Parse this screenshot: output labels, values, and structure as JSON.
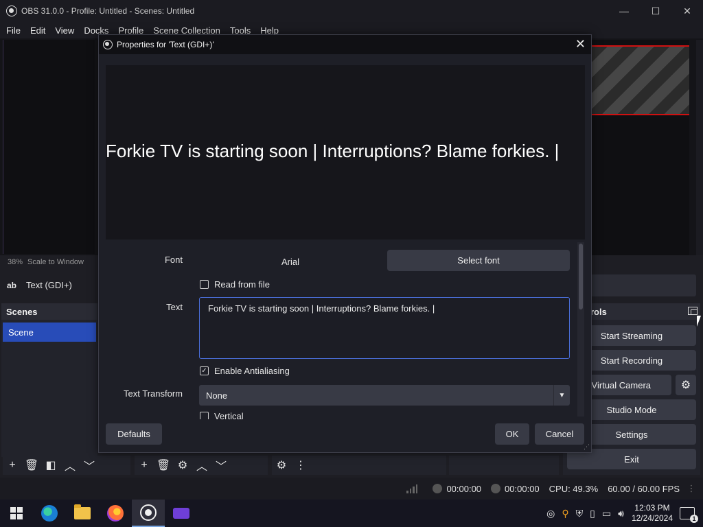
{
  "window": {
    "title": "OBS 31.0.0 - Profile: Untitled - Scenes: Untitled",
    "minimize_glyph": "—",
    "maximize_glyph": "☐",
    "close_glyph": "✕"
  },
  "menubar": [
    "File",
    "Edit",
    "View",
    "Docks",
    "Profile",
    "Scene Collection",
    "Tools",
    "Help"
  ],
  "preview_status": {
    "zoom": "38%",
    "scale_mode": "Scale to Window"
  },
  "sources": {
    "selected_icon": "ab",
    "selected_label": "Text (GDI+)"
  },
  "scenes_dock": {
    "title": "Scenes",
    "items": [
      "Scene"
    ]
  },
  "controls_dock": {
    "title": "rols",
    "buttons": {
      "start_streaming": "Start Streaming",
      "start_recording": "Start Recording",
      "virtual_camera": "rt Virtual Camera",
      "studio_mode": "Studio Mode",
      "settings": "Settings",
      "exit": "Exit"
    }
  },
  "status_bar": {
    "stream_time": "00:00:00",
    "record_time": "00:00:00",
    "cpu": "CPU: 49.3%",
    "fps": "60.00 / 60.00 FPS"
  },
  "dialog": {
    "title": "Properties for 'Text (GDI+)'",
    "preview_text": "Forkie TV is starting soon | Interruptions? Blame forkies. |",
    "font_label": "Font",
    "font_value": "Arial",
    "select_font_button": "Select font",
    "read_from_file_label": "Read from file",
    "read_from_file_checked": false,
    "text_label": "Text",
    "text_value": "Forkie TV is starting soon | Interruptions? Blame forkies. |",
    "antialiasing_label": "Enable Antialiasing",
    "antialiasing_checked": true,
    "text_transform_label": "Text Transform",
    "text_transform_value": "None",
    "vertical_label": "Vertical",
    "defaults_button": "Defaults",
    "ok_button": "OK",
    "cancel_button": "Cancel"
  },
  "taskbar": {
    "clock_time": "12:03 PM",
    "clock_date": "12/24/2024",
    "notification_count": "1"
  },
  "colors": {
    "accent": "#284cb8",
    "recording_stripe": "#d01010",
    "dialog_bg": "#1e1f27",
    "button_bg": "#383a45"
  }
}
